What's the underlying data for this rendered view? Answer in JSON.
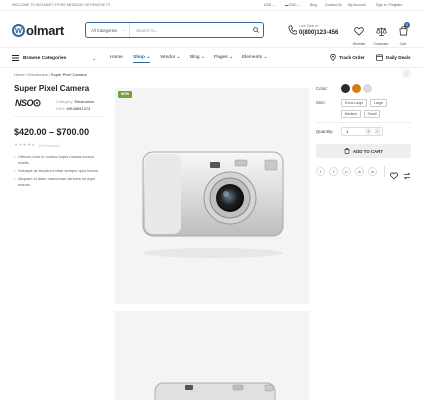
{
  "topbar": {
    "welcome": "WELCOME TO WOLMART STORE MESSAGE OR REMOVE IT!",
    "currency": "USD",
    "language": "ENG",
    "links": [
      "Blog",
      "Contact Us",
      "My Account",
      "Sign In / Register"
    ]
  },
  "header": {
    "logo_mark": "w",
    "logo_text": "olmart",
    "search_category": "All Categories",
    "search_placeholder": "Search in...",
    "phone_label": "Live Chat or :",
    "phone_number": "0(800)123-456",
    "icons": [
      {
        "label": "Wishlist",
        "icon": "heart-icon"
      },
      {
        "label": "Compare",
        "icon": "compare-icon"
      },
      {
        "label": "Cart",
        "icon": "cart-icon",
        "badge": "0"
      }
    ]
  },
  "nav": {
    "browse": "Browse Categories",
    "items": [
      "Home",
      "Shop",
      "Vendor",
      "Blog",
      "Pages",
      "Elements"
    ],
    "active": "Shop",
    "right": [
      "Track Order",
      "Daily Deals"
    ]
  },
  "breadcrumb": [
    "Home",
    "Electronics",
    "Super Pixel Camera"
  ],
  "product": {
    "title": "Super Pixel Camera",
    "brand_logo": "NSO",
    "category_label": "Category:",
    "category": "Electronics",
    "sku_label": "SKU:",
    "sku": "MS46891373",
    "price": "$420.00 – $700.00",
    "reviews": "(3 Reviews)",
    "features": [
      "Ultrices eros in cursus turpis massa cursus mattis.",
      "Volutpat ac tincidunt vitae semper quis lectus.",
      "Aliquam id diam maecenas ultricies mi eget mauris."
    ],
    "badge": "NEW",
    "color_label": "Color:",
    "colors": [
      "#2b2b2b",
      "#d67a1b",
      "#dadada"
    ],
    "size_label": "Size:",
    "sizes": [
      "Extra Large",
      "Large",
      "Medium",
      "Small"
    ],
    "quantity_label": "Quantity:",
    "quantity": "1",
    "add_to_cart": "ADD TO CART",
    "social": [
      "f",
      "t",
      "p",
      "w",
      "in"
    ]
  },
  "colors": {
    "accent": "#336699",
    "badge_green": "#71a33b"
  }
}
